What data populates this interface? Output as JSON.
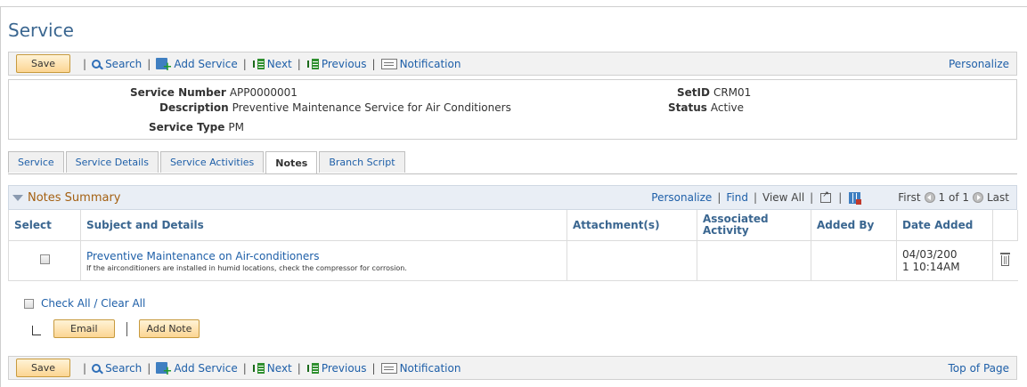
{
  "page": {
    "title": "Service"
  },
  "toolbar": {
    "save": "Save",
    "search": "Search",
    "add_service": "Add Service",
    "next": "Next",
    "previous": "Previous",
    "notification": "Notification",
    "separator": "|",
    "personalize": "Personalize",
    "top_of_page": "Top of Page"
  },
  "header": {
    "service_number_label": "Service Number",
    "service_number": "APP0000001",
    "description_label": "Description",
    "description": "Preventive Maintenance Service for Air Conditioners",
    "service_type_label": "Service Type",
    "service_type": "PM",
    "setid_label": "SetID",
    "setid": "CRM01",
    "status_label": "Status",
    "status": "Active"
  },
  "tabs": [
    "Service",
    "Service Details",
    "Service Activities",
    "Notes",
    "Branch Script"
  ],
  "active_tab": "Notes",
  "grid": {
    "title": "Notes Summary",
    "personalize": "Personalize",
    "find": "Find",
    "view_all": "View All",
    "separator": "|",
    "first": "First",
    "page_range": "1 of 1",
    "last": "Last",
    "columns": [
      "Select",
      "Subject and Details",
      "Attachment(s)",
      "Associated Activity",
      "Added By",
      "Date Added"
    ],
    "rows": [
      {
        "subject": "Preventive Maintenance on Air-conditioners",
        "details": "If the airconditioners are installed in humid locations, check the compressor for corrosion.",
        "attachment": "",
        "activity": "",
        "added_by": "",
        "date_line1": "04/03/200",
        "date_line2": "1 10:14AM"
      }
    ]
  },
  "actions": {
    "check_all": "Check All / Clear All",
    "email": "Email",
    "add_note": "Add Note"
  },
  "colors": {
    "link": "#1e5fa8",
    "title": "#3a6690",
    "grid_title": "#a46012",
    "button_bg": "#fcd592"
  }
}
